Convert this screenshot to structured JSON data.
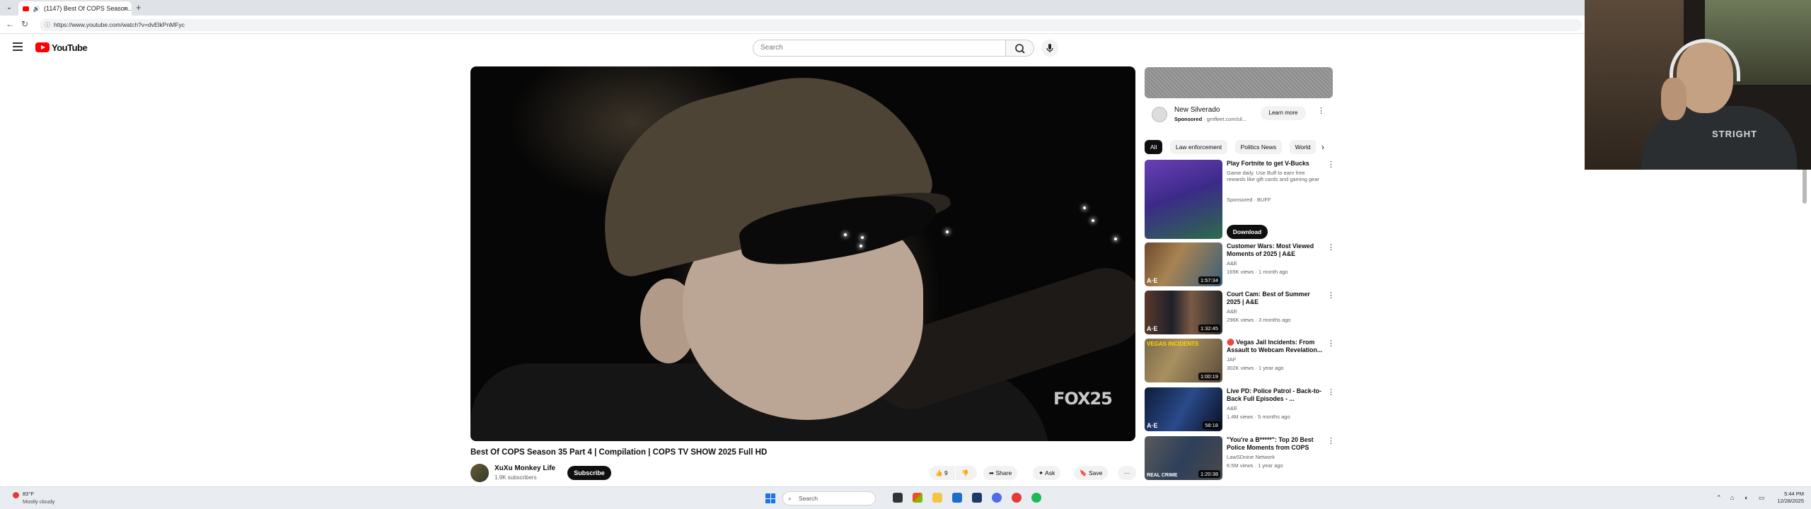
{
  "browser": {
    "tab_title": "(1147) Best Of COPS Season...",
    "new_tab": "+",
    "url": "https://www.youtube.com/watch?v=dvElkPnMFyc",
    "back_glyph": "←",
    "reload_glyph": "↻"
  },
  "youtube": {
    "logo_text": "YouTube",
    "search_placeholder": "Search"
  },
  "video": {
    "watermark": "FOX25",
    "title": "Best Of COPS Season 35 Part 4 | Compilation | COPS TV SHOW 2025 Full HD",
    "channel": "XuXu Monkey Life",
    "subscribers": "1.9K subscribers",
    "subscribe_label": "Subscribe",
    "likes": "9",
    "share_label": "Share",
    "ask_label": "Ask",
    "save_label": "Save",
    "more_label": "···"
  },
  "sponsored_ad": {
    "title": "New Silverado",
    "sponsored_label": "Sponsored",
    "advertiser": "· gmfleet.com/sil...",
    "cta": "Learn more"
  },
  "chips": [
    "All",
    "Law enforcement",
    "Politics News",
    "World"
  ],
  "recommendations": [
    {
      "title": "Play Fortnite to get V-Bucks",
      "description": "Game daily. Use Buff to earn free rewards like gift cards and gaming gear",
      "channel": "Sponsored · BUFF",
      "cta": "Download",
      "duration": ""
    },
    {
      "title": "Customer Wars: Most Viewed Moments of 2025 | A&E",
      "channel": "A&E",
      "meta": "165K views · 1 month ago",
      "duration": "1:57:34",
      "tag": "A·E"
    },
    {
      "title": "Court Cam: Best of Summer 2025 | A&E",
      "channel": "A&E",
      "meta": "296K views · 3 months ago",
      "duration": "1:32:45",
      "tag": "A·E"
    },
    {
      "title": "🔴 Vegas Jail Incidents: From Assault to Webcam Revelation...",
      "channel": "JAF",
      "meta": "302K views · 1 year ago",
      "duration": "1:00:19",
      "tag": "VEGAS INCIDENTS"
    },
    {
      "title": "Live PD: Police Patrol - Back-to-Back Full Episodes - ...",
      "channel": "A&E",
      "meta": "1.4M views · 5 months ago",
      "duration": "58:18",
      "tag": "A·E"
    },
    {
      "title": "\"You're a B*****\": Top 20 Best Police Moments from COPS",
      "channel": "LawSDnine Network",
      "meta": "6.5M views · 1 year ago",
      "duration": "1:20:38",
      "tag": "REAL CRIME"
    }
  ],
  "webcam": {
    "shirt_text": "STRIGHT"
  },
  "taskbar": {
    "weather_temp": "83°F",
    "weather_desc": "Mostly cloudy",
    "search_placeholder": "Search",
    "clock_time": "5:44 PM",
    "clock_date": "12/28/2025"
  }
}
